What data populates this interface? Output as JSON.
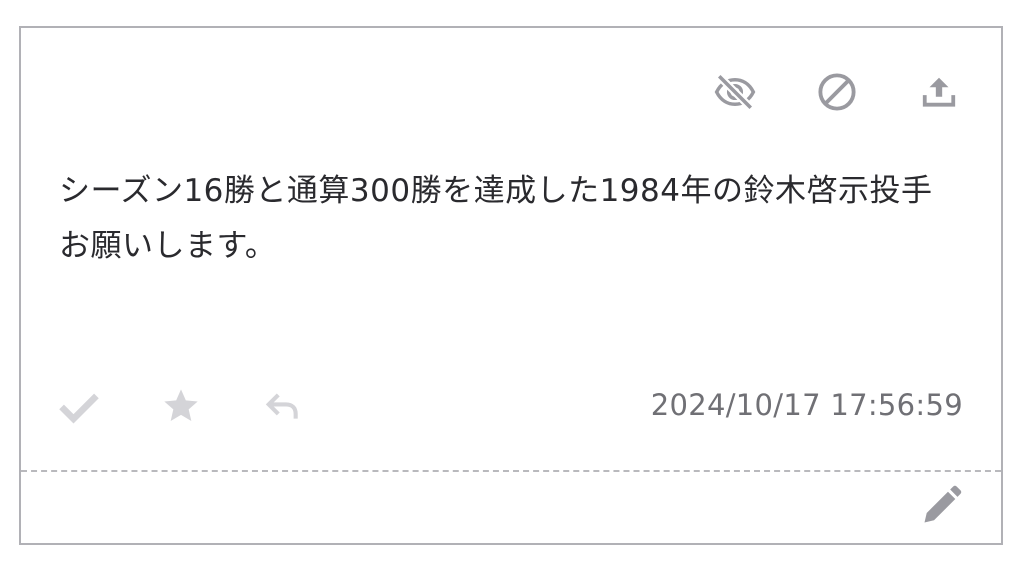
{
  "message": {
    "text": "シーズン16勝と通算300勝を達成した1984年の鈴木啓示投手お願いします。",
    "timestamp": "2024/10/17 17:56:59"
  },
  "icons": {
    "hide": "eye-slash-icon",
    "block": "block-icon",
    "share": "upload-icon",
    "check": "check-icon",
    "star": "star-icon",
    "reply": "reply-icon",
    "edit": "pencil-icon"
  },
  "colors": {
    "icon_active": "#9a9aa0",
    "icon_muted": "#d4d4d8",
    "text": "#2a2a2e",
    "timestamp": "#707075",
    "border": "#b1b1b6"
  }
}
